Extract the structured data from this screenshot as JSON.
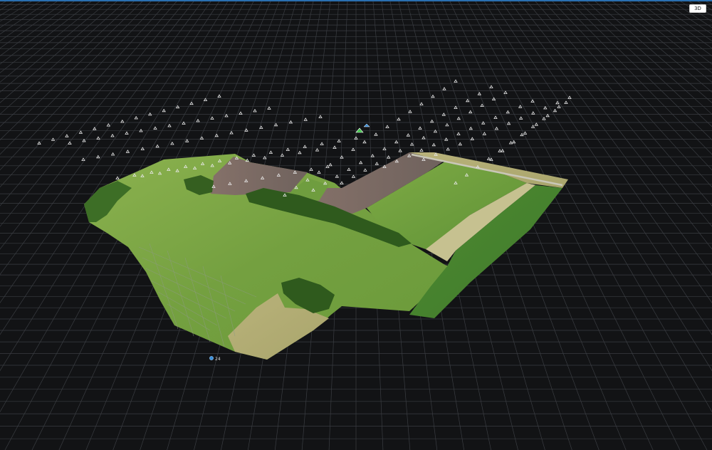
{
  "toolbar": {
    "view_mode_label": "3D"
  },
  "markers": {
    "ground_control_point_label": "24"
  },
  "colors": {
    "background": "#121315",
    "grid_line": "#3a3d42",
    "field_light": "#7fa548",
    "field_dark": "#5e8a35",
    "soil": "#7a6a62",
    "camera_marker": "#e8e8e8",
    "gcp_marker": "#3a8fd8",
    "selected_marker": "#45c850"
  },
  "icons": {
    "camera_position": "camera-position-icon",
    "ground_control_point": "gcp-icon",
    "selected_camera": "selected-camera-icon"
  }
}
